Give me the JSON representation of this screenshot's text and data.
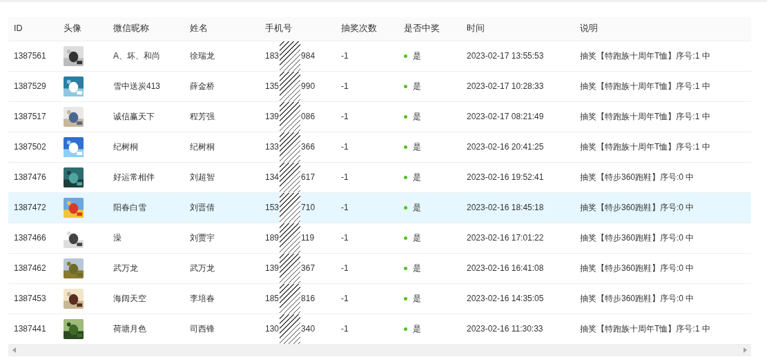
{
  "table": {
    "columns": [
      "ID",
      "头像",
      "微信昵称",
      "姓名",
      "手机号",
      "抽奖次数",
      "是否中奖",
      "时间",
      "说明"
    ],
    "rows": [
      {
        "id": "1387561",
        "nickname": "A、坏、和尚",
        "name": "徐瑞龙",
        "phone_start": "183",
        "phone_end": "984",
        "draws": "-1",
        "won": {
          "kind": "success",
          "text": "是"
        },
        "time": "2023-02-17 13:55:53",
        "note": "抽奖【特跑族十周年T恤】序号:1 中",
        "selected": false
      },
      {
        "id": "1387529",
        "nickname": "雪中送炭413",
        "name": "薛金桥",
        "phone_start": "135",
        "phone_end": "990",
        "draws": "-1",
        "won": {
          "kind": "success",
          "text": "是"
        },
        "time": "2023-02-17 10:28:33",
        "note": "抽奖【特跑族十周年T恤】序号:1 中",
        "selected": false
      },
      {
        "id": "1387517",
        "nickname": "诚信赢天下",
        "name": "程芳强",
        "phone_start": "139",
        "phone_end": "086",
        "draws": "-1",
        "won": {
          "kind": "success",
          "text": "是"
        },
        "time": "2023-02-17 08:21:49",
        "note": "抽奖【特跑族十周年T恤】序号:1 中",
        "selected": false
      },
      {
        "id": "1387502",
        "nickname": "纪树桐",
        "name": "纪树桐",
        "phone_start": "133",
        "phone_end": "366",
        "draws": "-1",
        "won": {
          "kind": "success",
          "text": "是"
        },
        "time": "2023-02-16 20:41:25",
        "note": "抽奖【特跑族十周年T恤】序号:1 中",
        "selected": false
      },
      {
        "id": "1387476",
        "nickname": "好运常相伴",
        "name": "刘超智",
        "phone_start": "134",
        "phone_end": "617",
        "draws": "-1",
        "won": {
          "kind": "success",
          "text": "是"
        },
        "time": "2023-02-16 19:52:41",
        "note": "抽奖【特步360跑鞋】序号:0 中",
        "selected": false
      },
      {
        "id": "1387472",
        "nickname": "阳春白雪",
        "name": "刘晋倩",
        "phone_start": "153",
        "phone_end": "710",
        "draws": "-1",
        "won": {
          "kind": "success",
          "text": "是"
        },
        "time": "2023-02-16 18:45:18",
        "note": "抽奖【特步360跑鞋】序号:0 中",
        "selected": true
      },
      {
        "id": "1387466",
        "nickname": "澡",
        "name": "刘贾宇",
        "phone_start": "189",
        "phone_end": "119",
        "draws": "-1",
        "won": {
          "kind": "success",
          "text": "是"
        },
        "time": "2023-02-16 17:01:22",
        "note": "抽奖【特步360跑鞋】序号:0 中",
        "selected": false
      },
      {
        "id": "1387462",
        "nickname": "武万龙",
        "name": "武万龙",
        "phone_start": "139",
        "phone_end": "367",
        "draws": "-1",
        "won": {
          "kind": "success",
          "text": "是"
        },
        "time": "2023-02-16 16:41:08",
        "note": "抽奖【特步360跑鞋】序号:0 中",
        "selected": false
      },
      {
        "id": "1387453",
        "nickname": "海阔天空",
        "name": "李培春",
        "phone_start": "185",
        "phone_end": "816",
        "draws": "-1",
        "won": {
          "kind": "success",
          "text": "是"
        },
        "time": "2023-02-16 14:35:05",
        "note": "抽奖【特步360跑鞋】序号:0 中",
        "selected": false
      },
      {
        "id": "1387441",
        "nickname": "荷塘月色",
        "name": "司西锋",
        "phone_start": "130",
        "phone_end": "340",
        "draws": "-1",
        "won": {
          "kind": "success",
          "text": "是"
        },
        "time": "2023-02-16 11:30:33",
        "note": "抽奖【特跑族十周年T恤】序号:1 中",
        "selected": false
      }
    ]
  }
}
